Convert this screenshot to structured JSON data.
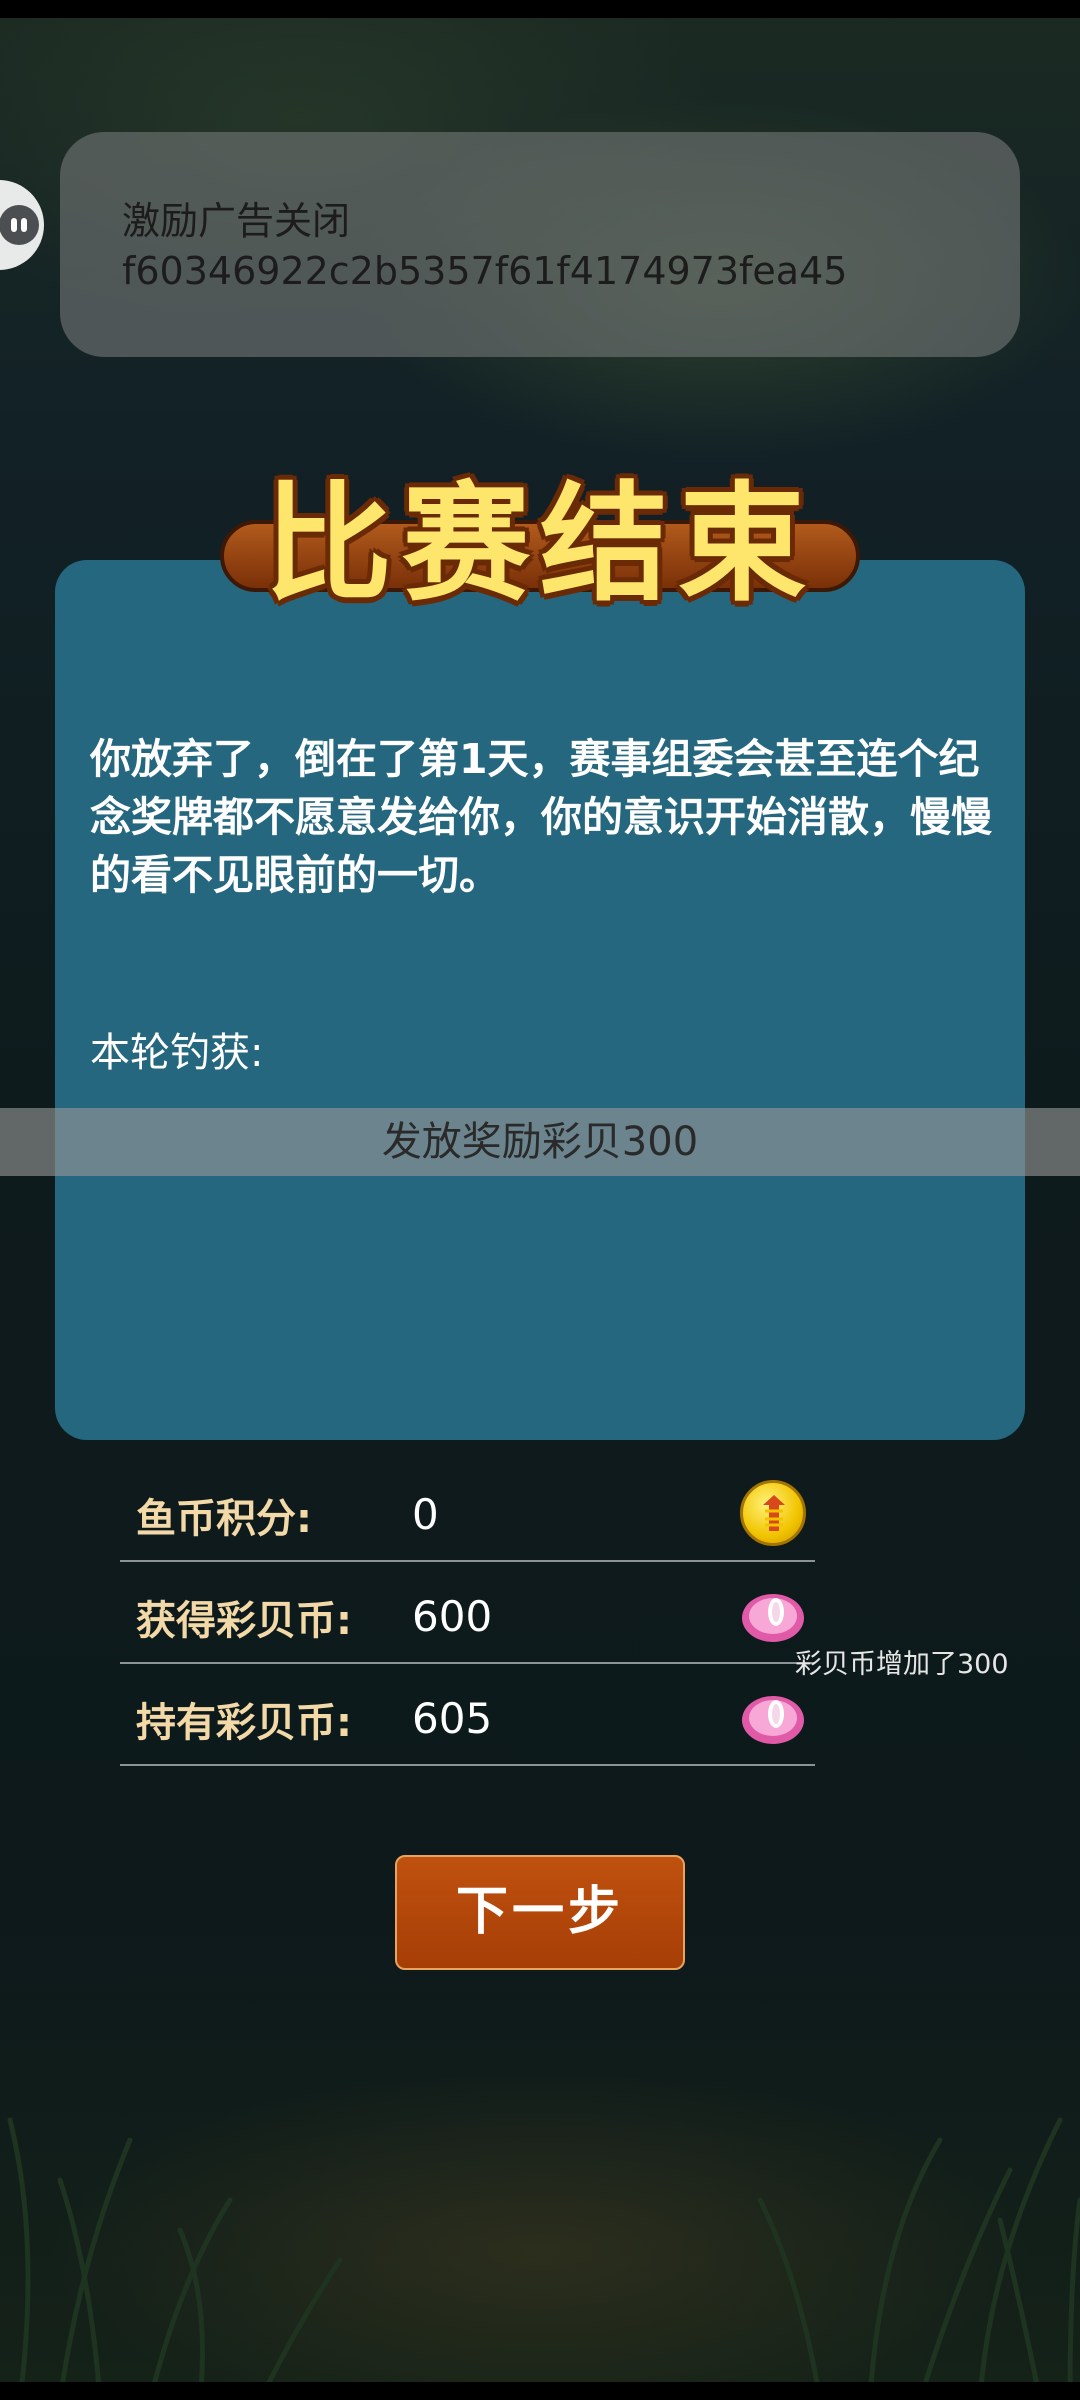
{
  "toast": {
    "line1": "激励广告关闭",
    "line2": "f60346922c2b5357f61f4174973fea45"
  },
  "result": {
    "title": "比赛结束",
    "story": "你放弃了，倒在了第1天，赛事组委会甚至连个纪念奖牌都不愿意发给你，你的意识开始消散，慢慢的看不见眼前的一切。",
    "catch_label": "本轮钓获:",
    "reward_notice": "发放奖励彩贝300"
  },
  "stats": [
    {
      "label": "鱼币积分:",
      "value": "0",
      "icon": "fish-coin-icon"
    },
    {
      "label": "获得彩贝币:",
      "value": "600",
      "icon": "shell-icon"
    },
    {
      "label": "持有彩贝币:",
      "value": "605",
      "icon": "shell-icon"
    }
  ],
  "float_message": "彩贝币增加了300",
  "next_button": "下一步",
  "colors": {
    "panel": "#25677f",
    "title": "#fde66b",
    "button": "#a63e06",
    "stat_label": "#f3d9a7"
  }
}
